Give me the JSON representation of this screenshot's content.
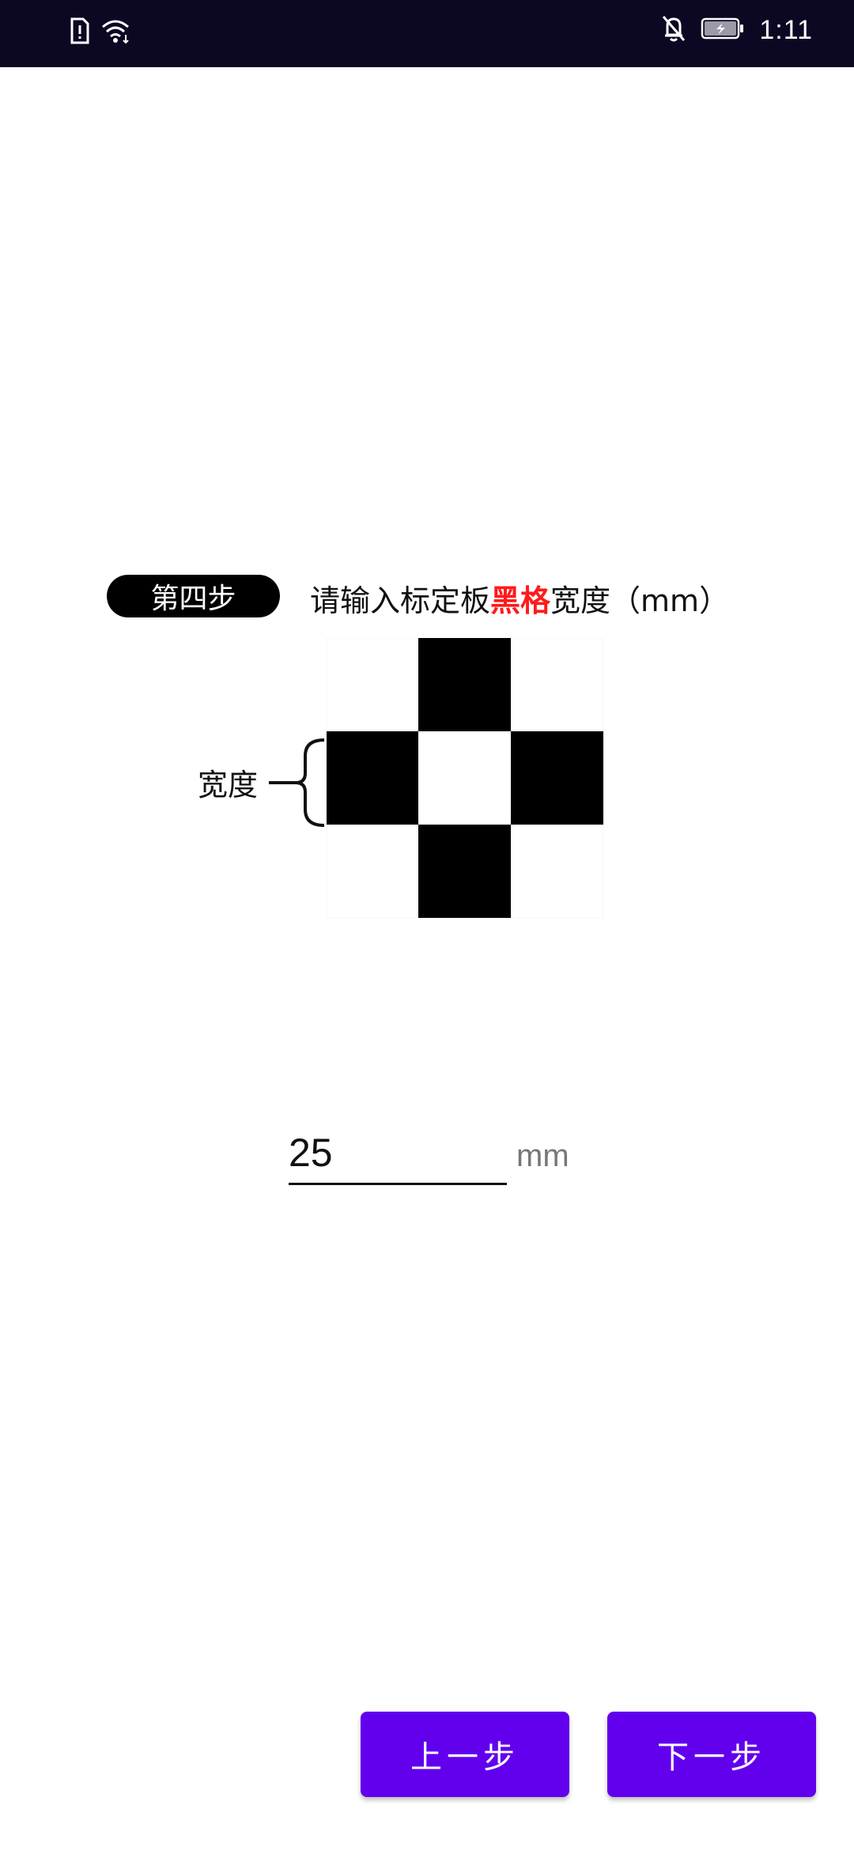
{
  "status_bar": {
    "time": "1:11",
    "icons": [
      "sim-alert-icon",
      "wifi-icon",
      "notifications-off-icon",
      "battery-charging-icon"
    ]
  },
  "step": {
    "badge": "第四步",
    "instruction_prefix": "请输入标定板",
    "instruction_highlight": "黑格",
    "instruction_suffix": "宽度（mm）"
  },
  "diagram": {
    "width_label": "宽度"
  },
  "input": {
    "value": "25",
    "unit": "mm"
  },
  "buttons": {
    "prev_label": "上一步",
    "next_label": "下一步"
  },
  "colors": {
    "status_bar": "#0c0823",
    "accent": "#6200ee",
    "highlight": "#ff1a1a"
  }
}
